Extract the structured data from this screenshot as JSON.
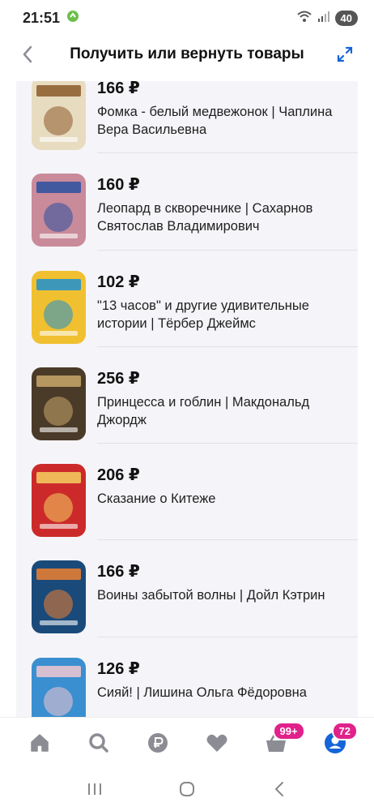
{
  "status_bar": {
    "time": "21:51",
    "battery": "40"
  },
  "header": {
    "title": "Получить или вернуть товары"
  },
  "items": [
    {
      "price": "166 ₽",
      "title": "Фомка - белый медвежонок | Чаплина Вера Васильевна",
      "cover_color": "#e8dcc0",
      "cover_accent": "#8a5a2a"
    },
    {
      "price": "160 ₽",
      "title": "Леопард в скворечнике | Сахарнов Святослав Владимирович",
      "cover_color": "#c98a9a",
      "cover_accent": "#2a4fa0"
    },
    {
      "price": "102 ₽",
      "title": "\"13 часов\" и другие удивительные истории | Тёрбер Джеймс",
      "cover_color": "#f0c030",
      "cover_accent": "#1d8fd0"
    },
    {
      "price": "256 ₽",
      "title": "Принцесса и гоблин | Макдональд Джордж",
      "cover_color": "#4a3a28",
      "cover_accent": "#c9a86a"
    },
    {
      "price": "206 ₽",
      "title": "Сказание о Китеже",
      "cover_color": "#cc2a2a",
      "cover_accent": "#f4d060"
    },
    {
      "price": "166 ₽",
      "title": "Воины забытой волны | Дойл Кэтрин",
      "cover_color": "#1a4a7a",
      "cover_accent": "#f08030"
    },
    {
      "price": "126 ₽",
      "title": "Сияй! | Лишина Ольга Фёдоровна",
      "cover_color": "#3a8fd0",
      "cover_accent": "#f2c8d0"
    }
  ],
  "bottom_nav": {
    "cart_badge": "99+",
    "profile_badge": "72"
  },
  "colors": {
    "accent": "#1565d8",
    "badge": "#e0228a",
    "icon_gray": "#8c8c94"
  }
}
